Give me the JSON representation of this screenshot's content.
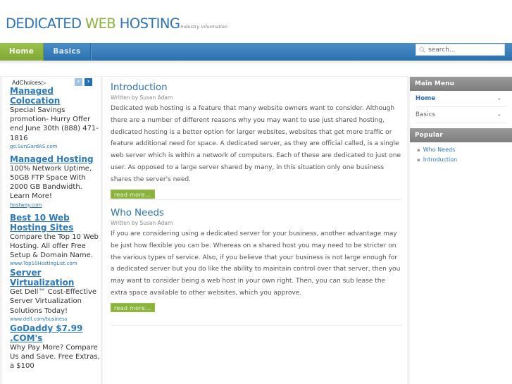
{
  "header": {
    "logo_part1": "DEDICATED ",
    "logo_part2": "WEB",
    "logo_part3": " HOSTING",
    "tagline": "Industry Information"
  },
  "nav": {
    "items": [
      {
        "label": "Home",
        "active": true
      },
      {
        "label": "Basics",
        "active": false
      }
    ],
    "search_placeholder": "search..."
  },
  "ads": {
    "adchoices_label": "AdChoices",
    "items": [
      {
        "title": "Managed Colocation",
        "body": "Special Savings promotion- Hurry Offer end June 30th (888) 471-1816",
        "url": "go.SunGardAS.com"
      },
      {
        "title": "Managed Hosting",
        "body": "100% Network Uptime, 50GB FTP Space With 2000 GB Bandwidth. Learn More!",
        "url": "hostway.com"
      },
      {
        "title": "Best 10 Web Hosting Sites",
        "body": "Compare the Top 10 Web Hosting. All offer Free Setup & Domain Name.",
        "url": "www.Top10HostingList.com"
      },
      {
        "title": "Server Virtualization",
        "body": "Get Dell™ Cost-Effective Server Virtualization Solutions Today!",
        "url": "www.dell.com/business"
      },
      {
        "title": "GoDaddy $7.99 .COM's",
        "body": "Why Pay More? Compare Us and Save. Free Extras, a $100",
        "url": ""
      }
    ]
  },
  "articles": [
    {
      "title": "Introduction",
      "meta": "Written by Susan Adam",
      "body": "Dedicated web hosting is a feature that many website owners want to consider. Although there are a number of different reasons why you may want to use just shared hosting, dedicated hosting is a better option for larger websites, websites that get more traffic or feature additional need for space. A dedicated server, as they are official called, is a single web server which is within a network of computers. Each of these are dedicated to just one user. As opposed to a large server shared by many, in this situation only one business shares the server's need.",
      "read_more": "read more..."
    },
    {
      "title": "Who Needs",
      "meta": "Written by Susan Adam",
      "body": "If you are considering using a dedicated server for your business, another advantage may be just how flexible you can be. Whereas on a shared host you may need to be stricter on the various types of service. Also, if you believe that your business is not large enough for a dedicated server but you do like the ability to maintain control over that server, then you may want to consider being a web host in your own right. Then, you can sub lease the extra space available to other websites, which you approve.",
      "read_more": "read more..."
    }
  ],
  "sidebar": {
    "main_menu_title": "Main Menu",
    "main_menu": [
      {
        "label": "Home",
        "active": true
      },
      {
        "label": "Basics",
        "active": false
      }
    ],
    "popular_title": "Popular",
    "popular": [
      {
        "label": "Who Needs"
      },
      {
        "label": "Introduction"
      }
    ]
  },
  "colors": {
    "brand_blue": "#2f74b5",
    "brand_green": "#8ab33b",
    "nav_blue": "#2d72b0",
    "sidebar_header_gray": "#8a8a8a"
  }
}
